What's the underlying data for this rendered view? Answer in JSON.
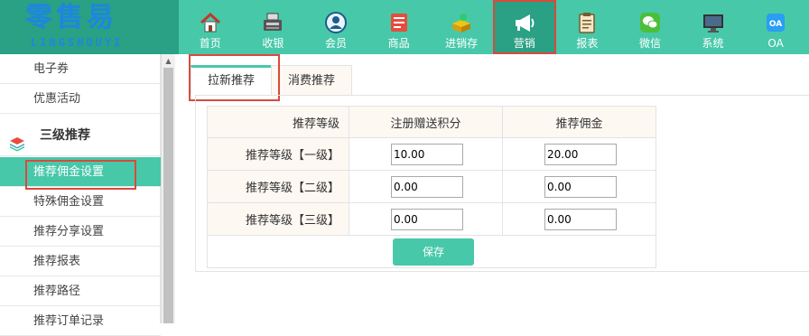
{
  "logo": {
    "title_cn": "零售易",
    "title_en": "LINGSHOUYI"
  },
  "nav": [
    {
      "label": "首页",
      "icon": "home-icon"
    },
    {
      "label": "收银",
      "icon": "cash-register-icon"
    },
    {
      "label": "会员",
      "icon": "member-icon"
    },
    {
      "label": "商品",
      "icon": "goods-icon"
    },
    {
      "label": "进销存",
      "icon": "inventory-icon"
    },
    {
      "label": "营销",
      "icon": "megaphone-icon",
      "active": true
    },
    {
      "label": "报表",
      "icon": "report-icon"
    },
    {
      "label": "微信",
      "icon": "wechat-icon"
    },
    {
      "label": "系统",
      "icon": "monitor-icon"
    },
    {
      "label": "OA",
      "icon": "oa-icon",
      "badge": "OA"
    }
  ],
  "sidebar": {
    "items_top": [
      "电子券",
      "优惠活动"
    ],
    "group": {
      "label": "三级推荐",
      "icon": "layers-icon"
    },
    "items": [
      "推荐佣金设置",
      "特殊佣金设置",
      "推荐分享设置",
      "推荐报表",
      "推荐路径",
      "推荐订单记录"
    ],
    "active": "推荐佣金设置"
  },
  "tabs": [
    "拉新推荐",
    "消费推荐"
  ],
  "table": {
    "headers": [
      "推荐等级",
      "注册赠送积分",
      "推荐佣金"
    ],
    "rows": [
      {
        "level": "推荐等级【一级】",
        "points": "10.00",
        "commission": "20.00"
      },
      {
        "level": "推荐等级【二级】",
        "points": "0.00",
        "commission": "0.00"
      },
      {
        "level": "推荐等级【三级】",
        "points": "0.00",
        "commission": "0.00"
      }
    ],
    "save_label": "保存"
  },
  "colors": {
    "accent": "#47c8a9",
    "accent_dark": "#2aa084",
    "highlight_box": "#d94a3d",
    "header_bg": "#fdf8f2"
  }
}
